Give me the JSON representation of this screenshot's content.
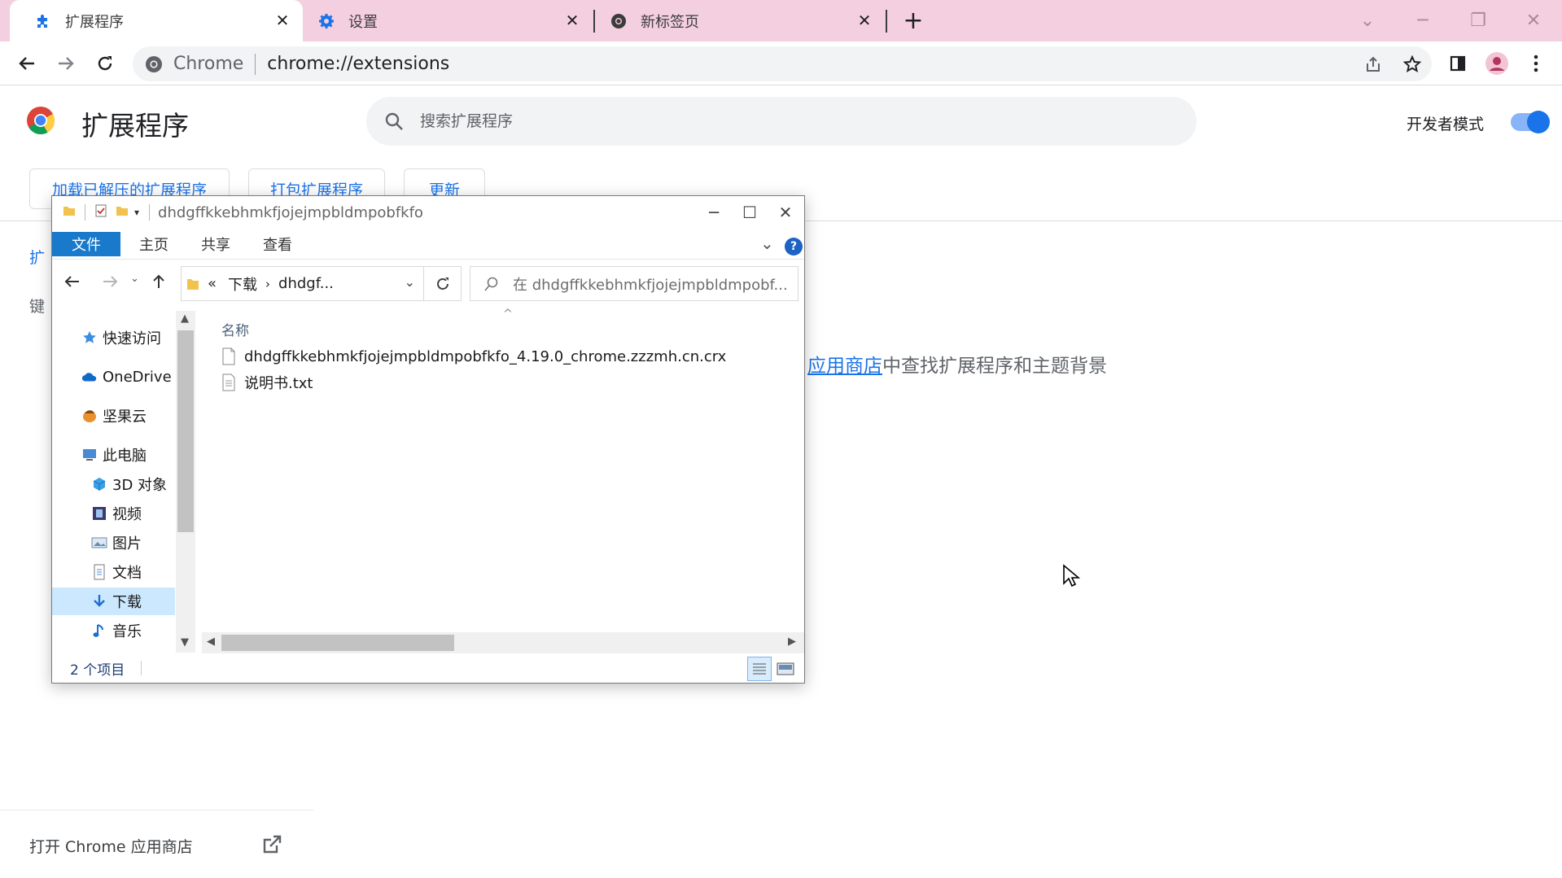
{
  "browser": {
    "tabs": [
      {
        "label": "扩展程序",
        "icon": "puzzle-icon",
        "active": true
      },
      {
        "label": "设置",
        "icon": "gear-icon",
        "active": false
      },
      {
        "label": "新标签页",
        "icon": "chrome-icon",
        "active": false
      }
    ],
    "omnibox": {
      "site_label": "Chrome",
      "url": "chrome://extensions"
    }
  },
  "extensions": {
    "title": "扩展程序",
    "search_placeholder": "搜索扩展程序",
    "dev_mode_label": "开发者模式",
    "dev_mode_on": true,
    "buttons": {
      "load_unpacked": "加载已解压的扩展程序",
      "pack": "打包扩展程序",
      "update": "更新"
    },
    "sidebar_fragment_1": "扩",
    "sidebar_fragment_2": "键",
    "empty_link": "应用商店",
    "empty_text": "中查找扩展程序和主题背景",
    "open_webstore": "打开 Chrome 应用商店"
  },
  "explorer": {
    "title": "dhdgffkkebhmkfjojejmpbldmpobfkfo",
    "ribbon_tabs": [
      "文件",
      "主页",
      "共享",
      "查看"
    ],
    "address": {
      "prefix": "«",
      "crumb1": "下载",
      "crumb2": "dhdgf..."
    },
    "search_placeholder": "在 dhdgffkkebhmkfjojejmpbldmpobf...",
    "nav_items": [
      {
        "label": "快速访问",
        "icon": "star-icon"
      },
      {
        "label": "OneDrive",
        "icon": "cloud-icon"
      },
      {
        "label": "坚果云",
        "icon": "nut-icon"
      },
      {
        "label": "此电脑",
        "icon": "computer-icon"
      },
      {
        "label": "3D 对象",
        "icon": "cube-icon"
      },
      {
        "label": "视频",
        "icon": "film-icon"
      },
      {
        "label": "图片",
        "icon": "picture-icon"
      },
      {
        "label": "文档",
        "icon": "document-icon"
      },
      {
        "label": "下载",
        "icon": "download-icon"
      },
      {
        "label": "音乐",
        "icon": "music-icon"
      }
    ],
    "column_name": "名称",
    "files": [
      {
        "name": "dhdgffkkebhmkfjojejmpbldmpobfkfo_4.19.0_chrome.zzzmh.cn.crx"
      },
      {
        "name": "说明书.txt"
      }
    ],
    "status": "2 个项目"
  }
}
